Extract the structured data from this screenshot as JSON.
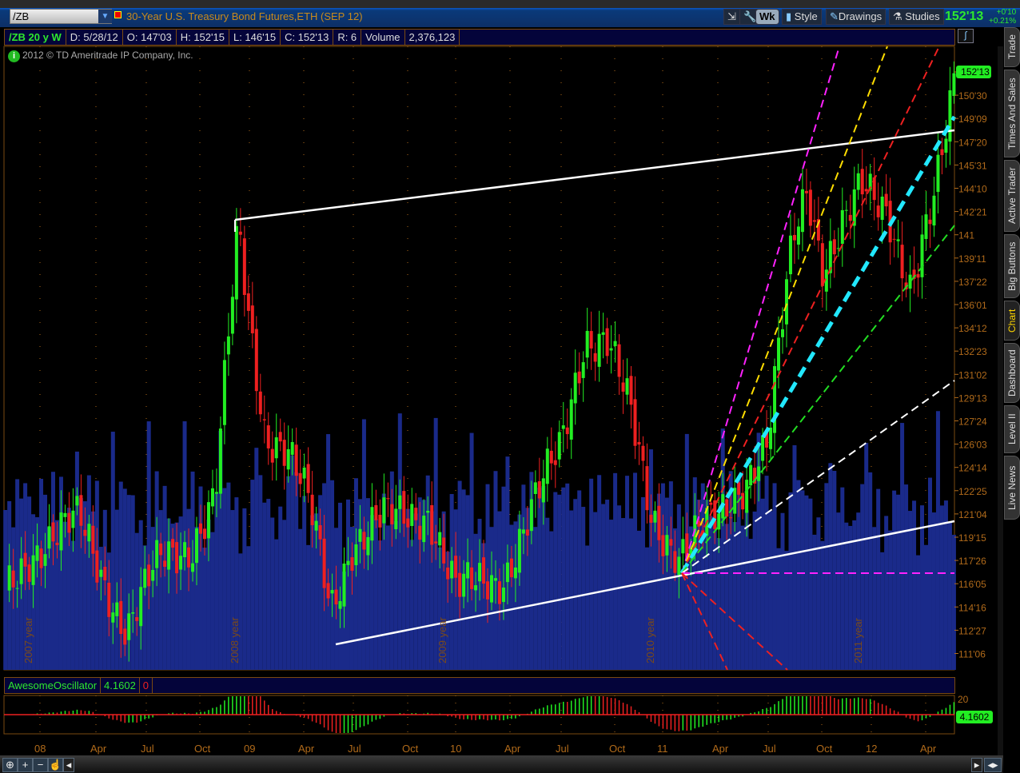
{
  "header": {
    "symbol": "/ZB",
    "title": "30-Year U.S. Treasury Bond Futures,ETH (SEP 12)",
    "buttons": {
      "period": "Wk",
      "style": "Style",
      "drawings": "Drawings",
      "studies": "Studies"
    },
    "last": "152'13",
    "change": "+0'10",
    "change_pct": "+0.21%"
  },
  "info": {
    "sym": "/ZB 20 y W",
    "date": "D: 5/28/12",
    "open": "O: 147'03",
    "high": "H: 152'15",
    "low": "L: 146'15",
    "close": "C: 152'13",
    "range": "R: 6",
    "vol_label": "Volume",
    "volume": "2,376,123"
  },
  "copyright": "2012 © TD Ameritrade IP Company, Inc.",
  "price_axis": [
    "152'13",
    "150'30",
    "149'09",
    "147'20",
    "145'31",
    "144'10",
    "142'21",
    "141",
    "139'11",
    "137'22",
    "136'01",
    "134'12",
    "132'23",
    "131'02",
    "129'13",
    "127'24",
    "126'03",
    "124'14",
    "122'25",
    "121'04",
    "119'15",
    "117'26",
    "116'05",
    "114'16",
    "112'27",
    "111'06"
  ],
  "time_axis": [
    "08",
    "Apr",
    "Jul",
    "Oct",
    "09",
    "Apr",
    "Jul",
    "Oct",
    "10",
    "Apr",
    "Jul",
    "Oct",
    "11",
    "Apr",
    "Jul",
    "Oct",
    "12",
    "Apr"
  ],
  "year_labels": [
    "2007 year",
    "2008 year",
    "2009 year",
    "2010 year",
    "2011 year"
  ],
  "oscillator": {
    "name": "AwesomeOscillator",
    "value": "4.1602",
    "zero": "0",
    "axis_top": "20"
  },
  "side_tabs": [
    "Trade",
    "Times And Sales",
    "Active Trader",
    "Big Buttons",
    "Chart",
    "Dashboard",
    "Level II",
    "Live News"
  ],
  "active_tab": "Chart",
  "colors": {
    "up": "#22ee22",
    "down": "#ee2020",
    "volume": "#1a2a8a",
    "axis": "#b06a1a",
    "accent": "#ffd700"
  },
  "chart_data": {
    "type": "candlestick",
    "interval": "weekly",
    "ylim": [
      111.1875,
      152.40625
    ],
    "close_path": [
      [
        "2007-11-01",
        115.5
      ],
      [
        "2007-12-15",
        118.3
      ],
      [
        "2008-03-10",
        120.6
      ],
      [
        "2008-04-20",
        116.6
      ],
      [
        "2008-06-01",
        112.7
      ],
      [
        "2008-07-30",
        117.8
      ],
      [
        "2008-09-25",
        118.9
      ],
      [
        "2008-11-05",
        122.3
      ],
      [
        "2008-11-25",
        132
      ],
      [
        "2008-12-15",
        141.4
      ],
      [
        "2009-01-01",
        135.4
      ],
      [
        "2009-02-01",
        126.9
      ],
      [
        "2009-03-10",
        125.7
      ],
      [
        "2009-04-20",
        121.2
      ],
      [
        "2009-05-25",
        114.4
      ],
      [
        "2009-07-01",
        118.9
      ],
      [
        "2009-08-25",
        120.6
      ],
      [
        "2009-11-15",
        121.2
      ],
      [
        "2010-01-01",
        115.5
      ],
      [
        "2010-03-25",
        116.6
      ],
      [
        "2010-07-01",
        125.7
      ],
      [
        "2010-08-15",
        133.7
      ],
      [
        "2010-09-25",
        133.1
      ],
      [
        "2010-11-05",
        128
      ],
      [
        "2010-12-10",
        121.2
      ],
      [
        "2011-01-30",
        117.8
      ],
      [
        "2011-04-10",
        121.2
      ],
      [
        "2011-07-01",
        125.7
      ],
      [
        "2011-08-15",
        140.5
      ],
      [
        "2011-09-10",
        144.5
      ],
      [
        "2011-10-08",
        138.8
      ],
      [
        "2011-12-15",
        144
      ],
      [
        "2012-01-30",
        142.8
      ],
      [
        "2012-03-10",
        137.1
      ],
      [
        "2012-04-22",
        143.4
      ],
      [
        "2012-05-28",
        152.4
      ]
    ]
  }
}
